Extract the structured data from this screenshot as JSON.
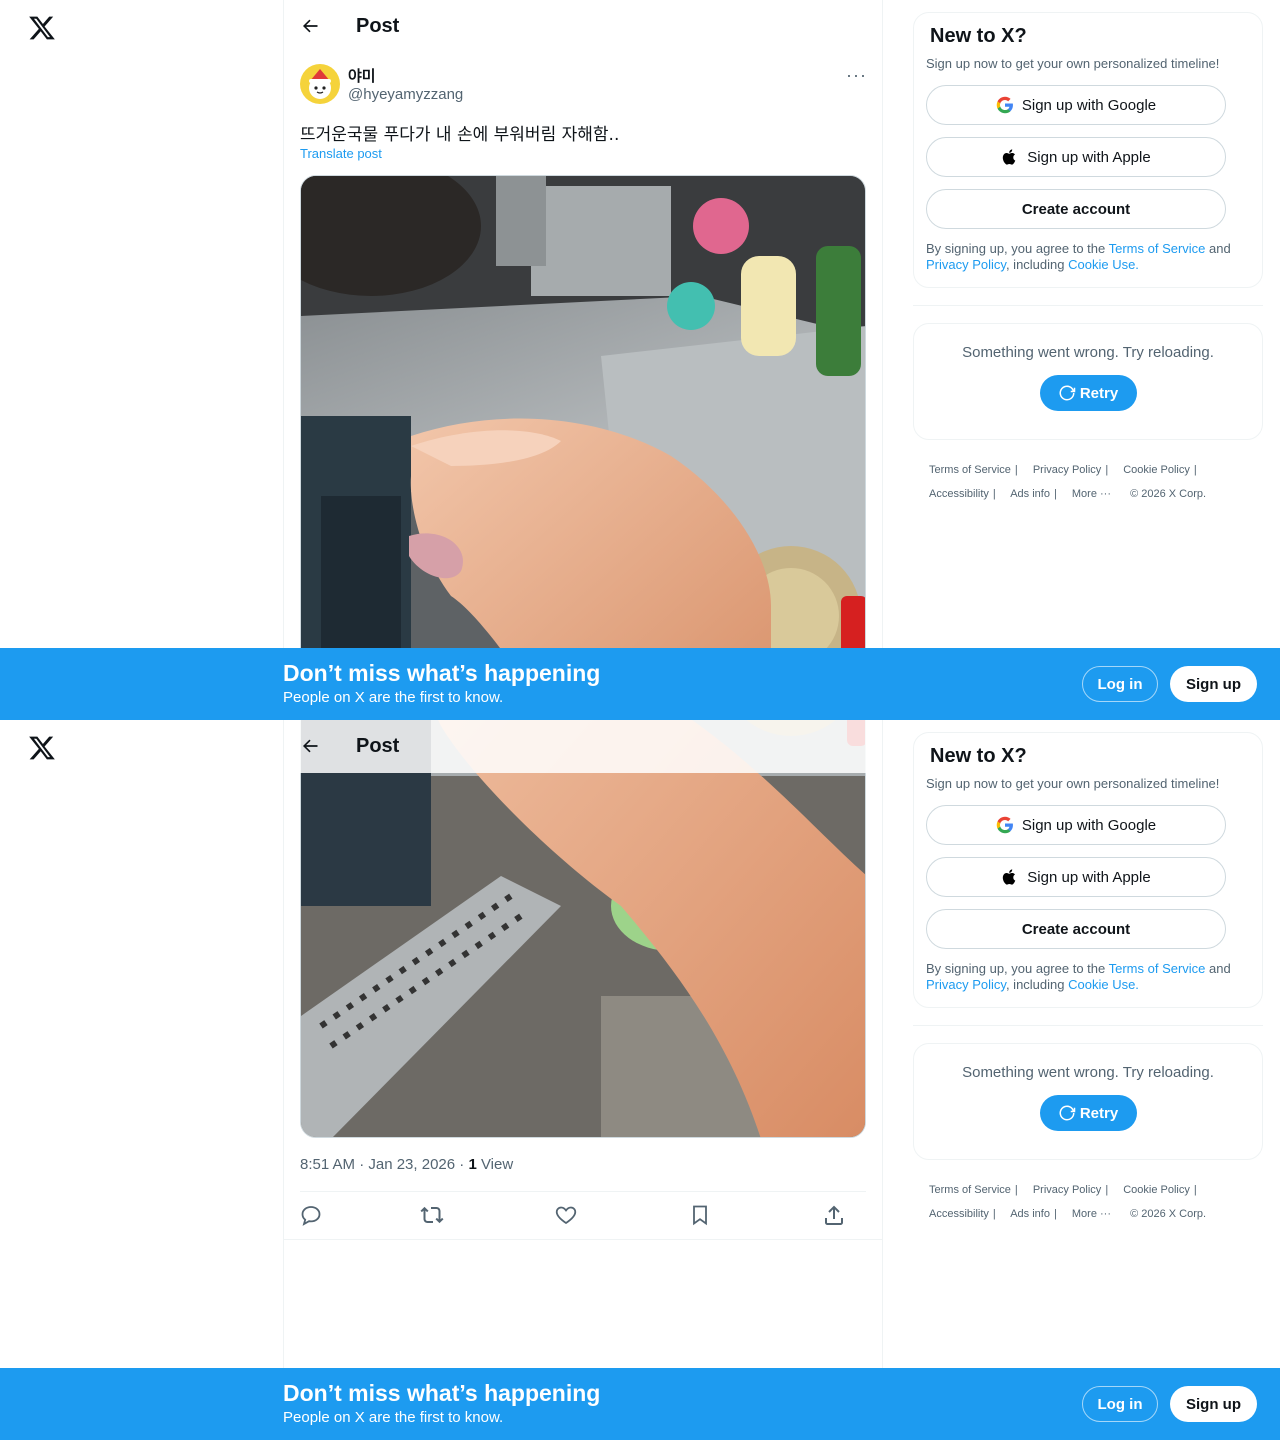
{
  "header": {
    "title": "Post"
  },
  "author": {
    "name": "야미",
    "handle": "@hyeyamyzzang"
  },
  "post": {
    "text": "뜨거운국물 푸다가 내 손에 부워버림 자해함..",
    "translate_label": "Translate post",
    "time": "8:51 AM · Jan 23, 2026 · ",
    "views_count": "1",
    "views_label": " View"
  },
  "signup_card": {
    "title": "New to X?",
    "subtitle": "Sign up now to get your own personalized timeline!",
    "google_label": "Sign up with Google",
    "apple_label": "Sign up with Apple",
    "create_label": "Create account",
    "legal_prefix": "By signing up, you agree to the ",
    "tos": "Terms of Service",
    "and": " and",
    "privacy": "Privacy Policy",
    "including": ", including ",
    "cookie": "Cookie Use."
  },
  "error_card": {
    "message": "Something went wrong. Try reloading.",
    "retry_label": "Retry"
  },
  "footer": {
    "links": [
      "Terms of Service",
      "Privacy Policy",
      "Cookie Policy",
      "Accessibility",
      "Ads info",
      "More ···"
    ],
    "copyright": "© 2026 X Corp."
  },
  "banner": {
    "title": "Don’t miss what’s happening",
    "subtitle": "People on X are the first to know.",
    "login_label": "Log in",
    "signup_label": "Sign up"
  },
  "colors": {
    "accent": "#1d9bf0",
    "text": "#0f1419",
    "muted": "#536471"
  }
}
